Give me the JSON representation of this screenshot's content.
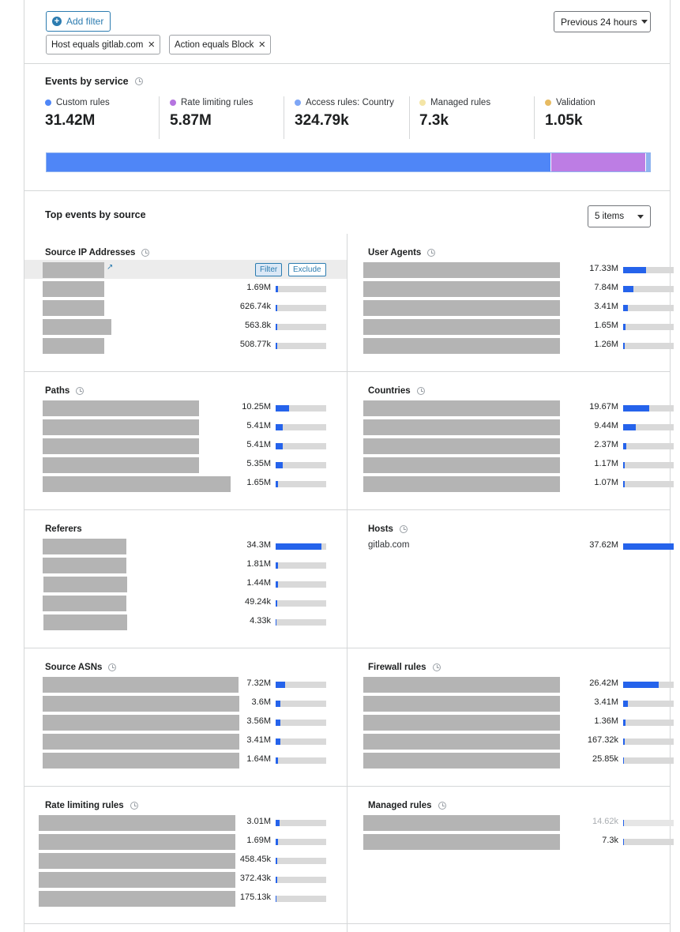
{
  "filters": {
    "add_label": "Add filter",
    "period": "Previous 24 hours",
    "chips": [
      {
        "field": "Host",
        "op": "equals",
        "value": "gitlab.com"
      },
      {
        "field": "Action",
        "op": "equals",
        "value": "Block"
      }
    ]
  },
  "services": {
    "title": "Events by service",
    "items": [
      {
        "label": "Custom rules",
        "value": "31.42M",
        "color": "#4f86f7"
      },
      {
        "label": "Rate limiting rules",
        "value": "5.87M",
        "color": "#b574e0"
      },
      {
        "label": "Access rules: Country",
        "value": "324.79k",
        "color": "#7ea6f6"
      },
      {
        "label": "Managed rules",
        "value": "7.3k",
        "color": "#f4e5a6"
      },
      {
        "label": "Validation",
        "value": "1.05k",
        "color": "#e7bb62"
      }
    ],
    "stack_colors": [
      "#4f86f7",
      "#bd7de4",
      "#8fb3ef"
    ]
  },
  "top": {
    "title": "Top events by source",
    "items_select": "5 items",
    "filter_btn": "Filter",
    "exclude_btn": "Exclude",
    "panels": {
      "source_ip": {
        "title": "Source IP Addresses",
        "rows": [
          {
            "value": "",
            "pct": 0
          },
          {
            "value": "1.69M",
            "pct": 0.05
          },
          {
            "value": "626.74k",
            "pct": 0.02
          },
          {
            "value": "563.8k",
            "pct": 0.02
          },
          {
            "value": "508.77k",
            "pct": 0.02
          }
        ]
      },
      "user_agents": {
        "title": "User Agents",
        "rows": [
          {
            "value": "17.33M",
            "pct": 0.46
          },
          {
            "value": "7.84M",
            "pct": 0.21
          },
          {
            "value": "3.41M",
            "pct": 0.09
          },
          {
            "value": "1.65M",
            "pct": 0.04
          },
          {
            "value": "1.26M",
            "pct": 0.03
          }
        ]
      },
      "paths": {
        "title": "Paths",
        "rows": [
          {
            "value": "10.25M",
            "pct": 0.27
          },
          {
            "value": "5.41M",
            "pct": 0.14
          },
          {
            "value": "5.41M",
            "pct": 0.14
          },
          {
            "value": "5.35M",
            "pct": 0.14
          },
          {
            "value": "1.65M",
            "pct": 0.04
          }
        ]
      },
      "countries": {
        "title": "Countries",
        "rows": [
          {
            "value": "19.67M",
            "pct": 0.52
          },
          {
            "value": "9.44M",
            "pct": 0.25
          },
          {
            "value": "2.37M",
            "pct": 0.06
          },
          {
            "value": "1.17M",
            "pct": 0.03
          },
          {
            "value": "1.07M",
            "pct": 0.03
          }
        ]
      },
      "referers": {
        "title": "Referers",
        "rows": [
          {
            "value": "34.3M",
            "pct": 0.91
          },
          {
            "value": "1.81M",
            "pct": 0.05
          },
          {
            "value": "1.44M",
            "pct": 0.04
          },
          {
            "value": "49.24k",
            "pct": 0.01
          },
          {
            "value": "4.33k",
            "pct": 0.0
          }
        ]
      },
      "hosts": {
        "title": "Hosts",
        "rows": [
          {
            "label": "gitlab.com",
            "value": "37.62M",
            "pct": 1.0
          }
        ]
      },
      "source_asns": {
        "title": "Source ASNs",
        "rows": [
          {
            "value": "7.32M",
            "pct": 0.19
          },
          {
            "value": "3.6M",
            "pct": 0.1
          },
          {
            "value": "3.56M",
            "pct": 0.09
          },
          {
            "value": "3.41M",
            "pct": 0.09
          },
          {
            "value": "1.64M",
            "pct": 0.04
          }
        ]
      },
      "firewall_rules": {
        "title": "Firewall rules",
        "rows": [
          {
            "value": "26.42M",
            "pct": 0.7
          },
          {
            "value": "3.41M",
            "pct": 0.09
          },
          {
            "value": "1.36M",
            "pct": 0.04
          },
          {
            "value": "167.32k",
            "pct": 0.01
          },
          {
            "value": "25.85k",
            "pct": 0.0
          }
        ]
      },
      "rate_limiting_rules": {
        "title": "Rate limiting rules",
        "rows": [
          {
            "value": "3.01M",
            "pct": 0.08
          },
          {
            "value": "1.69M",
            "pct": 0.05
          },
          {
            "value": "458.45k",
            "pct": 0.01
          },
          {
            "value": "372.43k",
            "pct": 0.01
          },
          {
            "value": "175.13k",
            "pct": 0.0
          }
        ]
      },
      "managed_rules": {
        "title": "Managed rules",
        "rows": [
          {
            "value": "14.62k",
            "pct": 0.0,
            "faded": true
          },
          {
            "value": "7.3k",
            "pct": 0.0
          }
        ]
      }
    }
  }
}
